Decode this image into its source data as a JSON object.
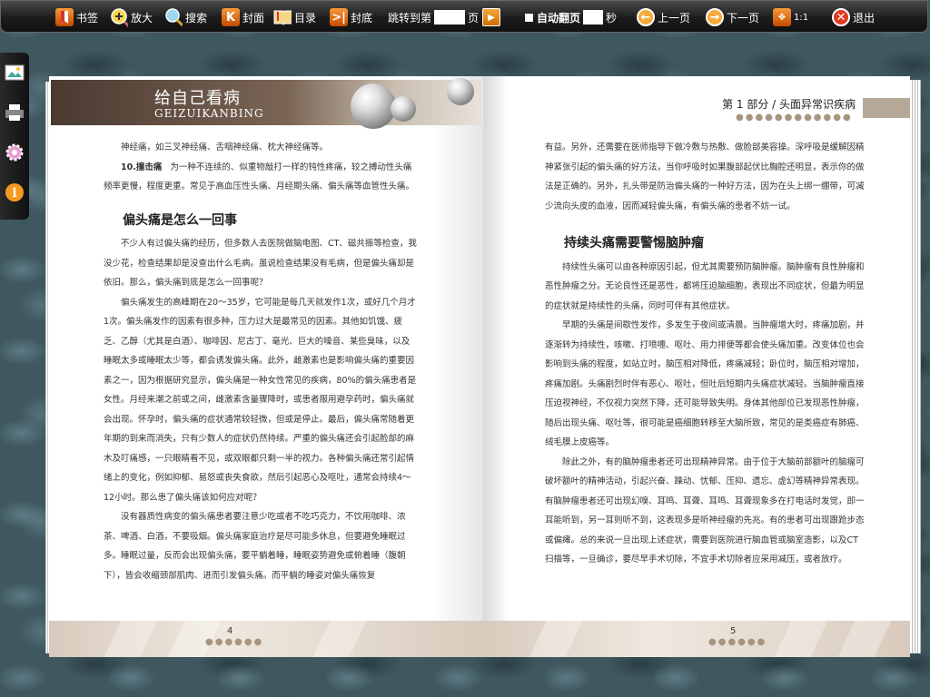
{
  "toolbar": {
    "bookmark": "书签",
    "zoom": "放大",
    "search": "搜索",
    "cover": "封面",
    "toc": "目录",
    "back_cover": "封底",
    "jump_label": "跳转到第",
    "jump_unit": "页",
    "auto_flip": "自动翻页",
    "seconds": "秒",
    "prev": "上一页",
    "next": "下一页",
    "ratio": "1:1",
    "exit": "退出"
  },
  "left_page": {
    "banner_title": "给自己看病",
    "banner_subtitle": "GEIZUIKANBING",
    "p1": "神经痛，如三叉神经痛、舌咽神经痛、枕大神经痛等。",
    "p2_num": "10.",
    "p2_bold": "撞击痛",
    "p2_rest": "为一种不连续的、似重物敲打一样的钝性疼痛，较之搏动性头痛频率更慢，程度更重。常见于高血压性头痛、月经期头痛、偏头痛等血管性头痛。",
    "heading": "偏头痛是怎么一回事",
    "p3": "不少人有过偏头痛的经历，但多数人去医院做脑电图、CT、磁共振等检查，我没少花，检查结果却是没查出什么毛病。虽说检查结果没有毛病，但是偏头痛却是依旧。那么，偏头痛到底是怎么一回事呢？",
    "p4": "偏头痛发生的高峰期在20～35岁，它可能是每几天就发作1次，或好几个月才1次。偏头痛发作的因素有很多种，压力过大是最常见的因素。其他如饥饿、疲乏、乙醇（尤其是白酒）、咖啡因、尼古丁、毫光、巨大的噪音、某些臭味，以及睡眠太多或睡眠太少等，都会诱发偏头痛。此外，雌激素也是影响偏头痛的重要因素之一，因为根据研究显示，偏头痛是一种女性常见的疾病，80%的偏头痛患者是女性。月经来潮之前或之间，雌激素含量骤降时，或患者服用避孕药时，偏头痛就会出现。怀孕时，偏头痛的症状通常较轻微，但或是停止。最后，偏头痛常随着更年期的到来而消失，只有少数人的症状仍然持续。严重的偏头痛还会引起脸部的麻木及叮痛感，一只眼睛看不见，或双眼都只剩一半的视力。各种偏头痛还常引起情绪上的变化，例如抑郁、易怒或丧失食欲，然后引起恶心及呕吐，通常会持续4～12小时。那么患了偏头痛该如何应对呢？",
    "p5": "没有器质性病变的偏头痛患者要注意少吃或者不吃巧克力，不饮用咖啡、浓茶、啤酒、白酒，不要吸烟。偏头痛家庭治疗是尽可能多休息，但要避免睡眠过多。睡眠过量，反而会出现偏头痛，要平躺着睡，睡眠姿势避免或俯着睡（腹朝下），皆会收缩颈部肌肉、进而引发偏头痛。而平躺的睡姿对偏头痛恢复",
    "page_number": "4"
  },
  "right_page": {
    "chapter": "第 1 部分 / 头面异常识疾病",
    "p1": "有益。另外，还需要在医师指导下做冷敷与热敷、做脸部美容操。深呼吸是缓解因精神紧张引起的偏头痛的好方法，当你呼吸时如果腹部起伏比胸腔还明显，表示你的做法是正确的。另外，扎头带是防治偏头痛的一种好方法，因为在头上绑一绷带，可减少流向头皮的血液，因而减轻偏头痛，有偏头痛的患者不妨一试。",
    "heading": "持续头痛需要警惕脑肿瘤",
    "p2": "持续性头痛可以由各种原因引起，但尤其需要预防脑肿瘤。脑肿瘤有良性肿瘤和恶性肿瘤之分。无论良性还是恶性，都将压迫脑细胞，表现出不同症状，但最为明显的症状就是持续性的头痛，同时可伴有其他症状。",
    "p3": "早期的头痛是间歇性发作，多发生于夜间或清晨。当肿瘤增大时，疼痛加剧，并逐渐转为持续性，咳嗽、打喷嚏、呕吐、用力排便等都会使头痛加重。改变体位也会影响到头痛的程度，如站立时，脑压相对降低，疼痛减轻；卧位时，脑压相对增加，疼痛加剧。头痛剧烈时伴有恶心、呕吐，但吐后短期内头痛症状减轻。当脑肿瘤直接压迫视神经，不仅视力突然下降，还可能导致失明。身体其他部位已发现恶性肿瘤，随后出现头痛、呕吐等，很可能是癌细胞转移至大脑所致，常见的是类癌症有肺癌、绒毛膜上皮癌等。",
    "p4": "除此之外，有的脑肿瘤患者还可出现精神异常。由于位于大脑前部额叶的脑瘤可破坏额叶的精神活动，引起兴奋、躁动、忧郁、压抑、遗忘、虚幻等精神异常表现。有脑肿瘤患者还可出现幻嗅、耳鸣、耳聋、耳鸣、耳聋现象多在打电话时发觉，即一耳能听到，另一耳则听不到，这表现多是听神经瘤的先兆。有的患者可出现跟跄步态或偏瘫。总的来说一旦出现上述症状，需要到医院进行脑血管或脑室造影，以及CT扫描等，一旦确诊，要尽早手术切除，不宜手术切除者应采用减压，或者放疗。",
    "page_number": "5"
  }
}
